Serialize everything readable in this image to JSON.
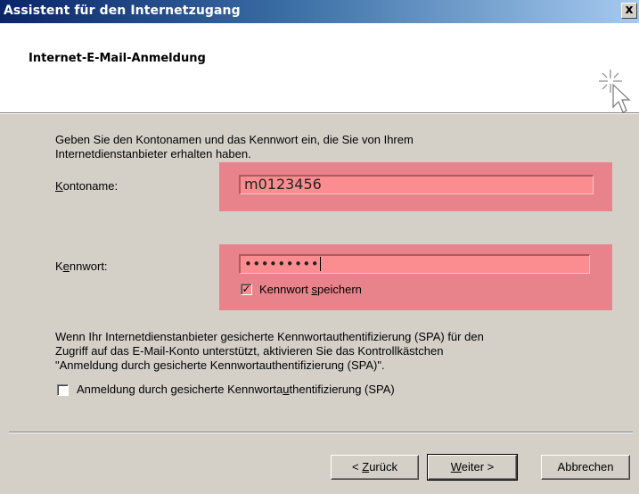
{
  "window": {
    "title": "Assistent für den Internetzugang",
    "close_label": "x"
  },
  "header": {
    "title": "Internet-E-Mail-Anmeldung",
    "icon": "wizard-cursor-icon"
  },
  "intro": {
    "line1": "Geben Sie den Kontonamen und das Kennwort ein, die Sie von Ihrem",
    "line2": "Internetdienstanbieter erhalten haben."
  },
  "account": {
    "label_accel": "K",
    "label_rest": "ontoname:",
    "value": "m0123456"
  },
  "password": {
    "label_pre": "K",
    "label_accel": "e",
    "label_rest": "nnwort:",
    "value": "•••••••••",
    "remember_pre": "Kennwort ",
    "remember_accel": "s",
    "remember_rest": "peichern",
    "remember_checked": "✓"
  },
  "spa": {
    "line1": "Wenn Ihr Internetdienstanbieter gesicherte Kennwortauthentifizierung (SPA) für den",
    "line2": "Zugriff auf das E-Mail-Konto unterstützt, aktivieren Sie das Kontrollkästchen",
    "line3": "\"Anmeldung durch gesicherte Kennwortauthentifizierung (SPA)\".",
    "checkbox_pre": "Anmeldung durch gesicherte Kennworta",
    "checkbox_accel": "u",
    "checkbox_rest": "thentifizierung (SPA)",
    "checked": false
  },
  "buttons": {
    "back_pre": "< ",
    "back_accel": "Z",
    "back_rest": "urück",
    "next_accel": "W",
    "next_rest": "eiter >",
    "cancel": "Abbrechen"
  },
  "colors": {
    "highlight": "#e8838b",
    "field": "#fb8d90",
    "titlebar": "#0a246a"
  }
}
